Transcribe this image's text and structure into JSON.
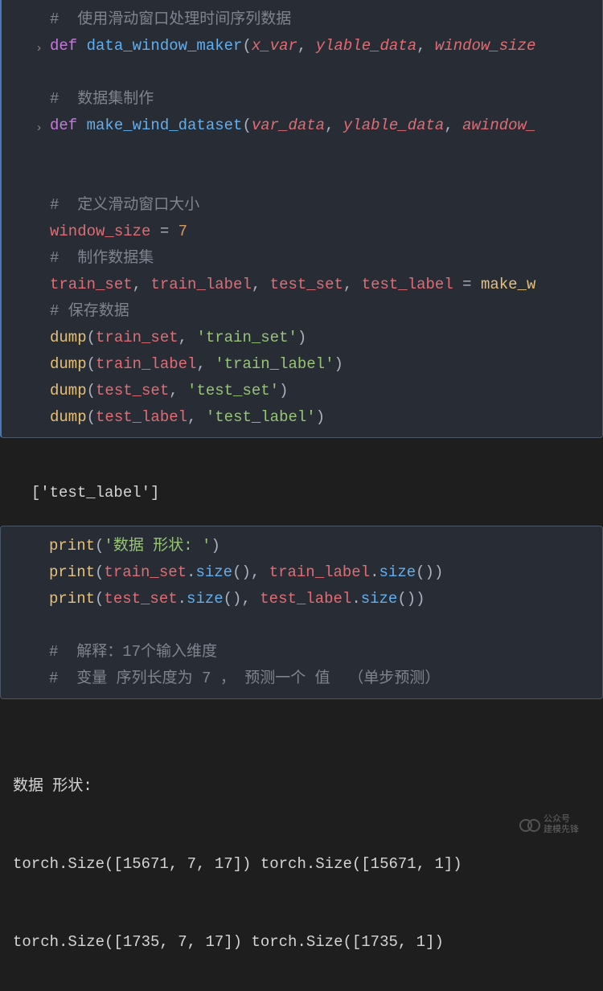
{
  "block1": {
    "l1": "#  使用滑动窗口处理时间序列数据",
    "l2": {
      "def": "def ",
      "name": "data_window_maker",
      "open": "(",
      "p1": "x_var",
      "c1": ", ",
      "p2": "ylable_data",
      "c2": ", ",
      "p3": "window_size"
    },
    "l3": "",
    "l4": "#  数据集制作",
    "l5": {
      "def": "def ",
      "name": "make_wind_dataset",
      "open": "(",
      "p1": "var_data",
      "c1": ", ",
      "p2": "ylable_data",
      "c2": ", ",
      "p3": "awindow_"
    },
    "l6": "",
    "l7": "",
    "l8": "#  定义滑动窗口大小",
    "l9": {
      "var": "window_size",
      "eq": " = ",
      "val": "7"
    },
    "l10": "#  制作数据集",
    "l11": {
      "v1": "train_set",
      "c1": ", ",
      "v2": "train_label",
      "c2": ", ",
      "v3": "test_set",
      "c3": ", ",
      "v4": "test_label",
      "eq": " = ",
      "fn": "make_w"
    },
    "l12": "# 保存数据",
    "l13": {
      "fn": "dump",
      "open": "(",
      "arg1": "train_set",
      "c": ", ",
      "str": "'train_set'",
      "close": ")"
    },
    "l14": {
      "fn": "dump",
      "open": "(",
      "arg1": "train_label",
      "c": ", ",
      "str": "'train_label'",
      "close": ")"
    },
    "l15": {
      "fn": "dump",
      "open": "(",
      "arg1": "test_set",
      "c": ", ",
      "str": "'test_set'",
      "close": ")"
    },
    "l16": {
      "fn": "dump",
      "open": "(",
      "arg1": "test_label",
      "c": ", ",
      "str": "'test_label'",
      "close": ")"
    }
  },
  "output1": "['test_label']",
  "block2": {
    "l1": {
      "fn": "print",
      "open": "(",
      "str": "'数据 形状: '",
      "close": ")"
    },
    "l2": {
      "fn": "print",
      "open": "(",
      "v1": "train_set",
      "dot1": ".",
      "m1": "size",
      "p1": "()",
      "c1": ", ",
      "v2": "train_label",
      "dot2": ".",
      "m2": "size",
      "p2": "()",
      "close": ")"
    },
    "l3": {
      "fn": "print",
      "open": "(",
      "v1": "test_set",
      "dot1": ".",
      "m1": "size",
      "p1": "()",
      "c1": ", ",
      "v2": "test_label",
      "dot2": ".",
      "m2": "size",
      "p2": "()",
      "close": ")"
    },
    "l4": "",
    "l5": "#  解释：17个输入维度",
    "l6": "#  变量 序列长度为 7 ， 预测一个 值  （单步预测）"
  },
  "output2": {
    "l1": "数据 形状:",
    "l2": "torch.Size([15671, 7, 17]) torch.Size([15671, 1])",
    "l3": "torch.Size([1735, 7, 17]) torch.Size([1735, 1])"
  },
  "watermark": {
    "top": "公众号",
    "bottom": "建模先锋"
  }
}
